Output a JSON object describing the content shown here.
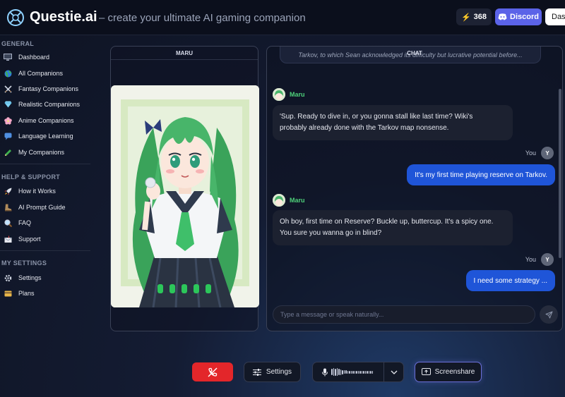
{
  "header": {
    "brand": "Questie.ai",
    "tagline": "– create your ultimate AI gaming companion",
    "coins": "368",
    "discord_label": "Discord",
    "dashboard_label": "Dashboard"
  },
  "sidebar": {
    "general_title": "GENERAL",
    "general_items": [
      {
        "label": "Dashboard",
        "icon": "monitor-icon"
      },
      {
        "label": "All Companions",
        "icon": "globe-icon"
      },
      {
        "label": "Fantasy Companions",
        "icon": "crossed-swords-icon"
      },
      {
        "label": "Realistic Companions",
        "icon": "diamond-icon"
      },
      {
        "label": "Anime Companions",
        "icon": "cherry-blossom-icon"
      },
      {
        "label": "Language Learning",
        "icon": "speech-icon"
      },
      {
        "label": "My Companions",
        "icon": "pencil-icon"
      }
    ],
    "help_title": "HELP & SUPPORT",
    "help_items": [
      {
        "label": "How it Works",
        "icon": "rocket-icon"
      },
      {
        "label": "AI Prompt Guide",
        "icon": "boot-icon"
      },
      {
        "label": "FAQ",
        "icon": "magnifier-icon"
      },
      {
        "label": "Support",
        "icon": "mailbox-icon"
      }
    ],
    "settings_title": "MY SETTINGS",
    "settings_items": [
      {
        "label": "Settings",
        "icon": "gear-icon"
      },
      {
        "label": "Plans",
        "icon": "card-icon"
      }
    ]
  },
  "companion_panel": {
    "title": "MARU"
  },
  "chat": {
    "title": "CHAT",
    "summary": "Tarkov, to which Sean acknowledged its difficulty but lucrative potential before...",
    "messages": [
      {
        "sender": "Maru",
        "text_line1": "'Sup. Ready to dive in, or you gonna stall like last time? Wiki's",
        "text_line2": "probably already done with the Tarkov map nonsense."
      },
      {
        "sender": "You",
        "avatar": "Y",
        "text": "It's my first time playing reserve on Tarkov."
      },
      {
        "sender": "Maru",
        "text_line1": "Oh boy, first time on Reserve? Buckle up, buttercup. It's a spicy one.",
        "text_line2": "You sure you wanna go in blind?"
      },
      {
        "sender": "You",
        "avatar": "Y",
        "text": "I need some strategy ..."
      }
    ],
    "input_placeholder": "Type a message or speak naturally...",
    "input_value": ""
  },
  "controls": {
    "settings_label": "Settings",
    "screenshare_label": "Screenshare"
  },
  "colors": {
    "accent_green": "#2cc65a",
    "user_bubble": "#1f55d8",
    "hangup_red": "#e3262a",
    "discord_blue": "#5b63e8"
  }
}
